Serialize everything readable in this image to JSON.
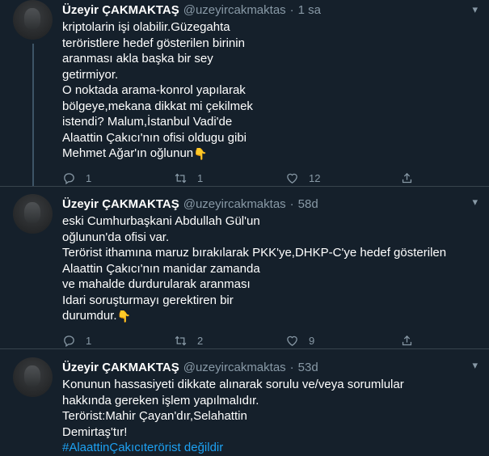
{
  "tweets": [
    {
      "name": "Üzeyir ÇAKMAKTAŞ",
      "handle": "@uzeyircakmaktas",
      "separator": "·",
      "time": "1 sa",
      "lines": [
        "kriptolarin işi olabilir.Güzegahta",
        "teröristlere hedef gösterilen birinin",
        "aranması akla başka bir sey",
        "getirmiyor.",
        "O noktada arama-konrol yapılarak",
        "bölgeye,mekana dikkat mi çekilmek",
        "istendi? Malum,İstanbul Vadi'de",
        "Alaattin Çakıcı'nın ofisi oldugu gibi",
        "Mehmet Ağar'ın oğlunun"
      ],
      "emoji": "👇",
      "replies": "1",
      "retweets": "1",
      "likes": "12"
    },
    {
      "name": "Üzeyir ÇAKMAKTAŞ",
      "handle": "@uzeyircakmaktas",
      "separator": "·",
      "time": "58d",
      "lines": [
        "eski Cumhurbaşkani Abdullah Gül'un",
        "oğlunun'da ofisi var.",
        "Terörist ithamına maruz bırakılarak PKK'ye,DHKP-C'ye hedef gösterilen",
        "Alaattin Çakıcı'nın manidar zamanda",
        "ve mahalde durdurularak aranması",
        "Idari soruşturmayı gerektiren bir",
        "durumdur."
      ],
      "emoji": "👇",
      "replies": "1",
      "retweets": "2",
      "likes": "9"
    },
    {
      "name": "Üzeyir ÇAKMAKTAŞ",
      "handle": "@uzeyircakmaktas",
      "separator": "·",
      "time": "53d",
      "lines": [
        "Konunun hassasiyeti dikkate alınarak sorulu ve/veya sorumlular",
        "hakkında gereken işlem yapılmalıdır.",
        "Terörist:Mahir Çayan'dır,Selahattin",
        "Demirtaş'tır!"
      ],
      "hashtag": "#AlaattinÇakıcıterörist değildir",
      "replies": "",
      "retweets": "",
      "likes": ""
    }
  ],
  "icons": {
    "reply": "reply-icon",
    "retweet": "retweet-icon",
    "like": "heart-icon",
    "share": "share-icon",
    "more": "chevron-down-icon"
  },
  "colors": {
    "background": "#15202b",
    "secondary_text": "#8899a6",
    "link": "#1da1f2",
    "divider": "#38444d",
    "thread_line": "#3d5466"
  }
}
